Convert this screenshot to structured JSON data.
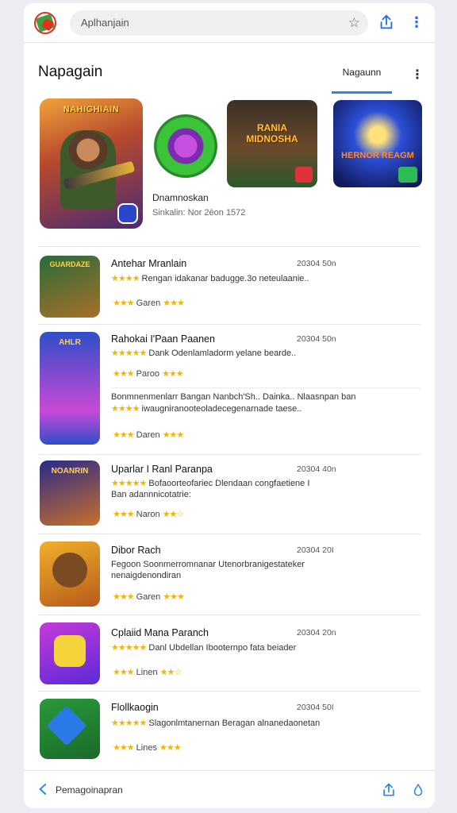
{
  "topbar": {
    "search_text": "Aplhanjain"
  },
  "header": {
    "title": "Napagain",
    "tab_active": "Nagaunn"
  },
  "featured": {
    "hero_title": "NAHIGHIAIN",
    "middle_title": "Dnamnoskan",
    "middle_sub": "Sinkalin: Nor 2ēon 1572",
    "card3_title": "RANIA MIDNOSHA",
    "card4_title": "HERNOR REAGM"
  },
  "list": [
    {
      "name": "Antehar Mranlain",
      "date": "20304 50n",
      "desc": "Rengan idakanar badugge.3o neteulaanie..",
      "meta": "Garen",
      "rating": 3,
      "rating2": 3,
      "icon_text": "GUARDAZE",
      "icon_colors": [
        "#2a6b3a",
        "#a8702a"
      ]
    },
    {
      "name": "Rahokai I'Paan Paanen",
      "date": "20304 50n",
      "desc": "Dank Odenlamladorm yelane bearde..",
      "meta": "Paroo",
      "rating": 3,
      "rating2": 3,
      "desc2_line1": "Bonmnenmenlarr Bangan Nanbch'Sh.. Dainka.. Nlaasnpan ban",
      "desc2_line2": "iwaugniranooteoladecegenarnade taese..",
      "meta2": "Daren",
      "icon_text": "AHLR",
      "icon_colors": [
        "#2f4ec8",
        "#c84ad8"
      ]
    },
    {
      "name": "Uparlar I Ranl Paranpa",
      "date": "20304 40n",
      "desc": "Bofaoorteofariec Dlendaan congfaetiene I Ban adannnicotatrie:",
      "meta": "Naron",
      "rating": 3,
      "rating2": 2,
      "icon_text": "NOANRIN",
      "icon_colors": [
        "#2a2a8a",
        "#c8702a"
      ]
    },
    {
      "name": "Dibor Rach",
      "date": "20304 20I",
      "desc": "Fegoon Soonmerromnanar Utenorbranigestateker nenaigdenondiran",
      "meta": "Garen",
      "rating": 3,
      "rating2": 3,
      "icon_text": "",
      "icon_colors": [
        "#f0b02a",
        "#b85a1a"
      ]
    },
    {
      "name": "Cplaiid Mana Paranch",
      "date": "20304 20n",
      "desc": "Danl Ubdellan Ibooternpo fata beiader",
      "meta": "Linen",
      "rating": 3,
      "rating2": 2,
      "icon_text": "",
      "icon_colors": [
        "#c83ad8",
        "#5a2ad8"
      ]
    },
    {
      "name": "Flollkaogin",
      "date": "20304 50I",
      "desc": "Slagonlmtanernan Beragan alnanedaonetan",
      "meta": "Lines",
      "rating": 3,
      "rating2": 3,
      "icon_text": "",
      "icon_colors": [
        "#2a9a3a",
        "#1a6a2a"
      ]
    }
  ],
  "bottombar": {
    "label": "Pemagoinapran"
  }
}
